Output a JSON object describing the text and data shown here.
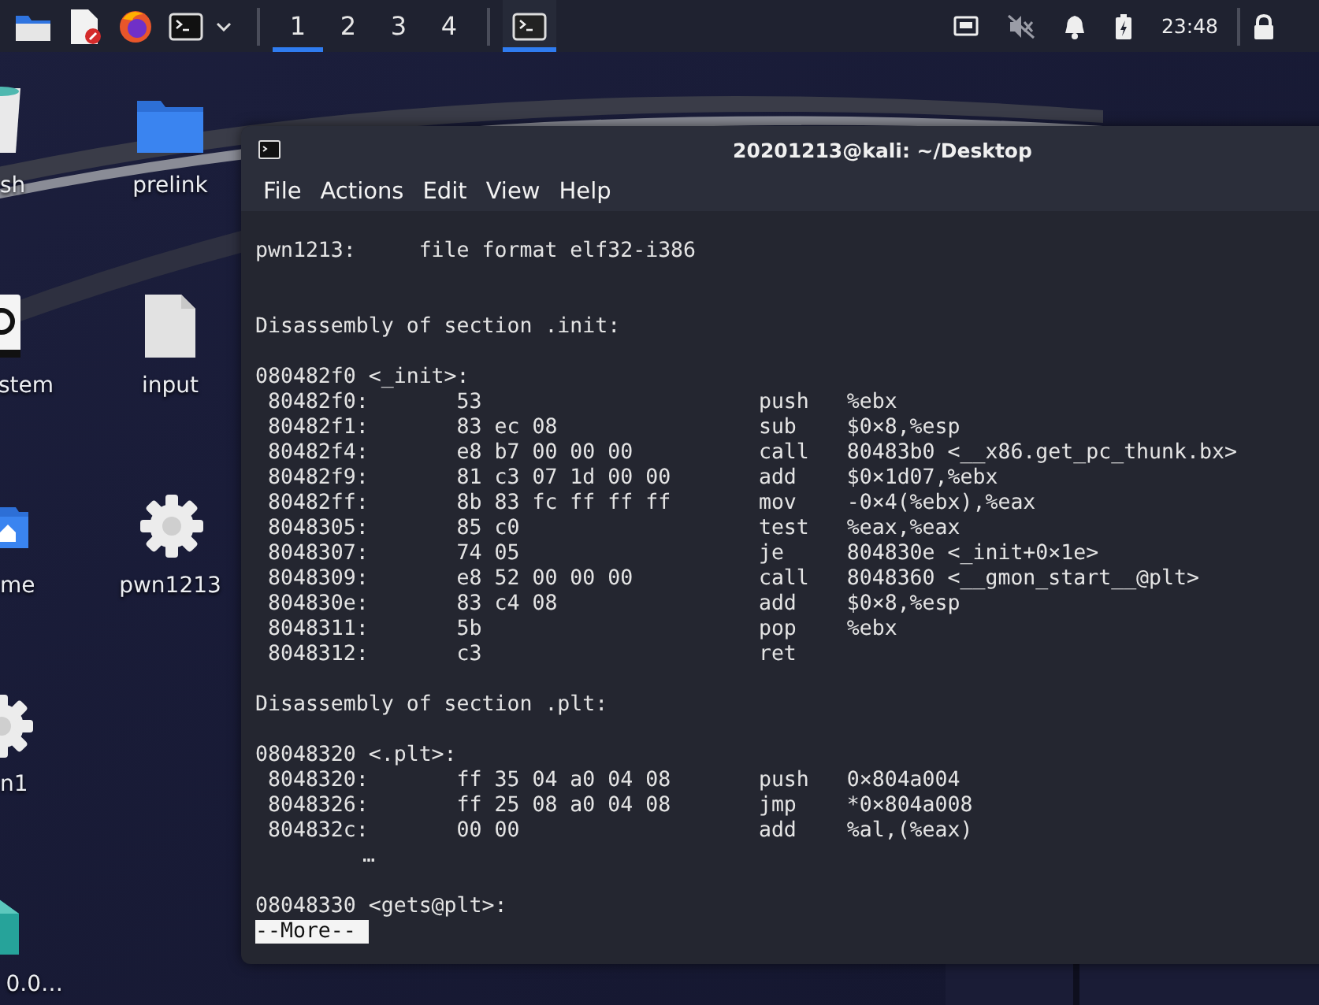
{
  "panel": {
    "launchers": [
      {
        "kind": "files"
      },
      {
        "kind": "editor"
      },
      {
        "kind": "browser"
      },
      {
        "kind": "terminal"
      }
    ],
    "workspaces": [
      {
        "label": "1",
        "selected": true
      },
      {
        "label": "2",
        "selected": false
      },
      {
        "label": "3",
        "selected": false
      },
      {
        "label": "4",
        "selected": false
      }
    ],
    "tasks": [
      {
        "kind": "terminal",
        "selected": true
      }
    ],
    "tray": {
      "muted": true,
      "clock": "23:48"
    }
  },
  "desktop_icons": [
    {
      "label": "sh",
      "kind": "trash"
    },
    {
      "label": "prelink",
      "kind": "folder"
    },
    {
      "label": "stem",
      "kind": "drive"
    },
    {
      "label": "input",
      "kind": "binary"
    },
    {
      "label": "me",
      "kind": "home"
    },
    {
      "label": "pwn1213",
      "kind": "gear"
    },
    {
      "label": "n1",
      "kind": "gear"
    },
    {
      "label": "0.0…",
      "kind": "package"
    }
  ],
  "terminal": {
    "title": "20201213@kali: ~/Desktop",
    "menu": [
      "File",
      "Actions",
      "Edit",
      "View",
      "Help"
    ],
    "lines": [
      {
        "kind": "text",
        "text": "pwn1213:     file format elf32-i386"
      },
      {
        "kind": "blank"
      },
      {
        "kind": "blank"
      },
      {
        "kind": "text",
        "text": "Disassembly of section .init:"
      },
      {
        "kind": "blank"
      },
      {
        "kind": "text",
        "text": "080482f0 <_init>:"
      },
      {
        "kind": "instruction",
        "address": "80482f0:",
        "bytes": "53",
        "mnemonic": "push",
        "operands": "%ebx"
      },
      {
        "kind": "instruction",
        "address": "80482f1:",
        "bytes": "83 ec 08",
        "mnemonic": "sub",
        "operands": "$0×8,%esp"
      },
      {
        "kind": "instruction",
        "address": "80482f4:",
        "bytes": "e8 b7 00 00 00",
        "mnemonic": "call",
        "operands": "80483b0 <__x86.get_pc_thunk.bx>"
      },
      {
        "kind": "instruction",
        "address": "80482f9:",
        "bytes": "81 c3 07 1d 00 00",
        "mnemonic": "add",
        "operands": "$0×1d07,%ebx"
      },
      {
        "kind": "instruction",
        "address": "80482ff:",
        "bytes": "8b 83 fc ff ff ff",
        "mnemonic": "mov",
        "operands": "-0×4(%ebx),%eax"
      },
      {
        "kind": "instruction",
        "address": "8048305:",
        "bytes": "85 c0",
        "mnemonic": "test",
        "operands": "%eax,%eax"
      },
      {
        "kind": "instruction",
        "address": "8048307:",
        "bytes": "74 05",
        "mnemonic": "je",
        "operands": "804830e <_init+0×1e>"
      },
      {
        "kind": "instruction",
        "address": "8048309:",
        "bytes": "e8 52 00 00 00",
        "mnemonic": "call",
        "operands": "8048360 <__gmon_start__@plt>"
      },
      {
        "kind": "instruction",
        "address": "804830e:",
        "bytes": "83 c4 08",
        "mnemonic": "add",
        "operands": "$0×8,%esp"
      },
      {
        "kind": "instruction",
        "address": "8048311:",
        "bytes": "5b",
        "mnemonic": "pop",
        "operands": "%ebx"
      },
      {
        "kind": "instruction",
        "address": "8048312:",
        "bytes": "c3",
        "mnemonic": "ret"
      },
      {
        "kind": "blank"
      },
      {
        "kind": "text",
        "text": "Disassembly of section .plt:"
      },
      {
        "kind": "blank"
      },
      {
        "kind": "text",
        "text": "08048320 <.plt>:"
      },
      {
        "kind": "instruction",
        "address": "8048320:",
        "bytes": "ff 35 04 a0 04 08",
        "mnemonic": "push",
        "operands": "0×804a004"
      },
      {
        "kind": "instruction",
        "address": "8048326:",
        "bytes": "ff 25 08 a0 04 08",
        "mnemonic": "jmp",
        "operands": "*0×804a008"
      },
      {
        "kind": "instruction",
        "address": "804832c:",
        "bytes": "00 00",
        "mnemonic": "add",
        "operands": "%al,(%eax)"
      },
      {
        "kind": "ellipsis",
        "text": "…"
      },
      {
        "kind": "blank"
      },
      {
        "kind": "text",
        "text": "08048330 <gets@plt>:"
      },
      {
        "kind": "pager",
        "text": "--More--"
      }
    ]
  }
}
